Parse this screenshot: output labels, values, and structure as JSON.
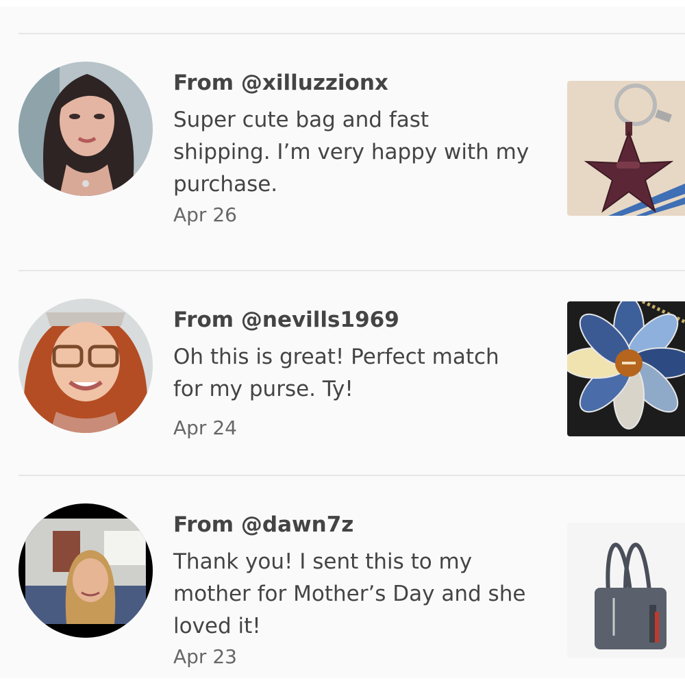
{
  "reviews": [
    {
      "from": "From @xilluzzionx",
      "text": "Super cute bag and fast shipping. I’m very happy with my purchase.",
      "date": "Apr 26",
      "avatar_icon": "woman-dark-hair-avatar",
      "thumb_icon": "star-keychain-thumbnail"
    },
    {
      "from": "From @nevills1969",
      "text": "Oh this is great! Perfect match for my purse. Ty!",
      "date": "Apr 24",
      "avatar_icon": "woman-red-hair-glasses-avatar",
      "thumb_icon": "flower-keychain-thumbnail"
    },
    {
      "from": "From @dawn7z",
      "text": "Thank you! I sent this to my mother for Mother’s Day and she loved it!",
      "date": "Apr 23",
      "avatar_icon": "woman-blonde-hair-avatar",
      "thumb_icon": "gray-handbag-thumbnail"
    }
  ]
}
